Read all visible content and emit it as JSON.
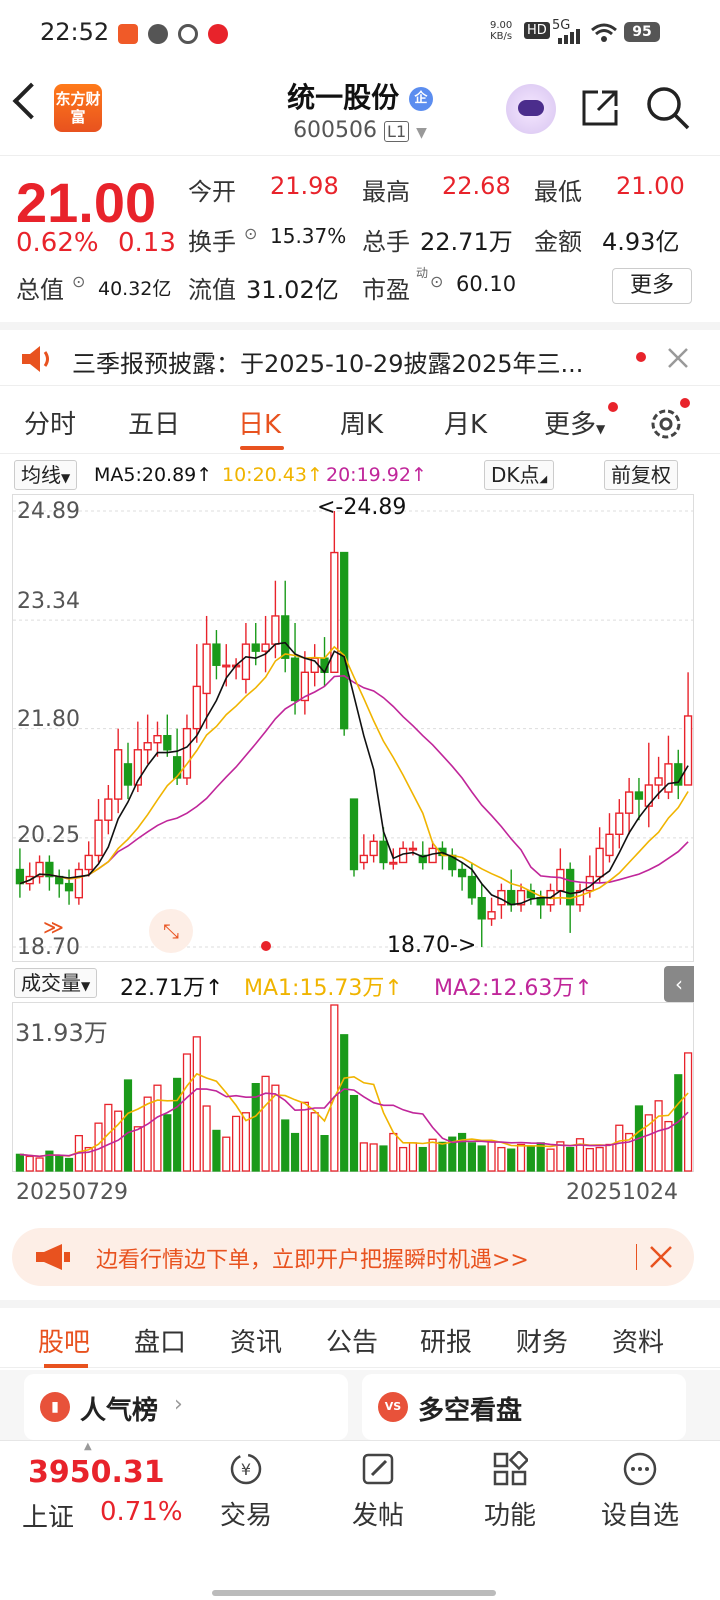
{
  "status_bar": {
    "time": "22:52",
    "net_speed": "9.00\nKB/s",
    "net_speed_top": "9.00",
    "net_speed_bottom": "KB/s",
    "hd": "HD",
    "signal": "5G",
    "battery": "95"
  },
  "header": {
    "logo_text": "东方财富",
    "stock_name": "统一股份",
    "stock_badge": "企",
    "stock_code": "600506",
    "level": "L1"
  },
  "quote": {
    "price": "21.00",
    "change_pct": "0.62%",
    "change_amt": "0.13",
    "open_label": "今开",
    "open_value": "21.98",
    "high_label": "最高",
    "high_value": "22.68",
    "low_label": "最低",
    "low_value": "21.00",
    "turnover_label": "换手",
    "turnover_value": "15.37%",
    "volume_label": "总手",
    "volume_value": "22.71万",
    "amount_label": "金额",
    "amount_value": "4.93亿",
    "mktcap_label": "总值",
    "mktcap_value": "40.32亿",
    "float_label": "流值",
    "float_value": "31.02亿",
    "pe_label": "市盈",
    "pe_sup": "动",
    "pe_value": "60.10",
    "more_label": "更多"
  },
  "notice": {
    "text": "三季报预披露：于2025-10-29披露2025年三..."
  },
  "period_tabs": [
    "分时",
    "五日",
    "日K",
    "周K",
    "月K",
    "更多"
  ],
  "active_period": "日K",
  "chart_toolbar": {
    "ma_select": "均线",
    "ma5": "MA5:20.89↑",
    "ma10": "10:20.43↑",
    "ma20": "20:19.92↑",
    "dk_label": "DK点",
    "adjust_label": "前复权"
  },
  "colors": {
    "up": "#e8232b",
    "down": "#1a9a1a",
    "accent": "#e8521f",
    "ma5": "#111111",
    "ma10": "#f0b400",
    "ma20": "#c0269a"
  },
  "chart_data": {
    "type": "candlestick",
    "y_ticks": [
      "24.89",
      "23.34",
      "21.80",
      "20.25",
      "18.70"
    ],
    "ylim": [
      18.7,
      24.89
    ],
    "max_annotation": "<-24.89",
    "min_annotation": "18.70->",
    "x_start": "20250729",
    "x_end": "20251024",
    "candles": [
      [
        19.8,
        19.6,
        20.1,
        19.4
      ],
      [
        19.6,
        19.7,
        19.9,
        19.5
      ],
      [
        19.7,
        19.9,
        20.0,
        19.6
      ],
      [
        19.9,
        19.7,
        20.0,
        19.5
      ],
      [
        19.7,
        19.6,
        19.8,
        19.4
      ],
      [
        19.6,
        19.5,
        19.8,
        19.3
      ],
      [
        19.4,
        19.8,
        19.9,
        19.3
      ],
      [
        19.8,
        20.0,
        20.2,
        19.7
      ],
      [
        20.0,
        20.5,
        20.8,
        19.9
      ],
      [
        20.5,
        20.8,
        21.0,
        20.3
      ],
      [
        20.8,
        21.5,
        21.8,
        20.6
      ],
      [
        21.3,
        21.0,
        21.6,
        20.8
      ],
      [
        21.0,
        21.5,
        21.9,
        20.9
      ],
      [
        21.5,
        21.6,
        22.0,
        21.3
      ],
      [
        21.6,
        21.7,
        21.9,
        21.4
      ],
      [
        21.7,
        21.5,
        22.0,
        21.4
      ],
      [
        21.4,
        21.1,
        21.8,
        21.0
      ],
      [
        21.1,
        21.8,
        22.0,
        21.0
      ],
      [
        21.8,
        22.4,
        23.0,
        21.6
      ],
      [
        22.3,
        23.0,
        23.4,
        21.8
      ],
      [
        23.0,
        22.7,
        23.2,
        22.5
      ],
      [
        22.7,
        22.7,
        23.0,
        22.4
      ],
      [
        22.7,
        22.7,
        22.8,
        22.5
      ],
      [
        22.5,
        23.0,
        23.3,
        22.3
      ],
      [
        23.0,
        22.9,
        23.3,
        22.7
      ],
      [
        22.9,
        23.0,
        23.4,
        22.6
      ],
      [
        23.0,
        23.4,
        23.9,
        22.8
      ],
      [
        23.4,
        22.8,
        23.9,
        22.6
      ],
      [
        22.8,
        22.2,
        23.3,
        22.0
      ],
      [
        22.2,
        22.6,
        22.9,
        22.0
      ],
      [
        22.6,
        22.8,
        23.0,
        22.4
      ],
      [
        22.8,
        22.6,
        23.1,
        22.4
      ],
      [
        22.6,
        24.3,
        24.89,
        22.6
      ],
      [
        24.3,
        21.8,
        24.3,
        21.7
      ],
      [
        20.8,
        19.8,
        20.8,
        19.7
      ],
      [
        19.9,
        20.0,
        20.3,
        19.8
      ],
      [
        20.0,
        20.2,
        20.3,
        19.9
      ],
      [
        20.2,
        19.9,
        20.4,
        19.8
      ],
      [
        19.9,
        19.9,
        20.1,
        19.8
      ],
      [
        19.9,
        20.1,
        20.2,
        19.9
      ],
      [
        20.1,
        20.1,
        20.2,
        20.0
      ],
      [
        20.0,
        19.9,
        20.2,
        19.8
      ],
      [
        19.9,
        20.1,
        20.2,
        19.9
      ],
      [
        20.1,
        20.0,
        20.2,
        19.8
      ],
      [
        20.0,
        19.8,
        20.1,
        19.7
      ],
      [
        19.8,
        19.7,
        19.9,
        19.5
      ],
      [
        19.7,
        19.4,
        19.9,
        19.3
      ],
      [
        19.4,
        19.1,
        19.6,
        18.7
      ],
      [
        19.1,
        19.2,
        19.4,
        19.0
      ],
      [
        19.3,
        19.5,
        19.6,
        19.1
      ],
      [
        19.5,
        19.3,
        19.8,
        19.2
      ],
      [
        19.3,
        19.5,
        19.6,
        19.2
      ],
      [
        19.5,
        19.4,
        19.6,
        19.3
      ],
      [
        19.4,
        19.3,
        19.5,
        19.1
      ],
      [
        19.3,
        19.5,
        19.6,
        19.2
      ],
      [
        19.5,
        19.8,
        20.1,
        19.3
      ],
      [
        19.8,
        19.3,
        19.9,
        18.9
      ],
      [
        19.3,
        19.5,
        19.6,
        19.2
      ],
      [
        19.5,
        19.7,
        20.0,
        19.4
      ],
      [
        19.7,
        20.1,
        20.4,
        19.6
      ],
      [
        20.0,
        20.3,
        20.6,
        19.9
      ],
      [
        20.3,
        20.6,
        20.8,
        20.1
      ],
      [
        20.6,
        20.9,
        21.1,
        20.3
      ],
      [
        20.9,
        20.8,
        21.1,
        20.5
      ],
      [
        20.7,
        21.0,
        21.6,
        20.4
      ],
      [
        21.0,
        21.1,
        21.4,
        20.8
      ],
      [
        20.9,
        21.3,
        21.7,
        20.8
      ],
      [
        21.3,
        21.0,
        21.5,
        20.8
      ],
      [
        21.0,
        21.98,
        22.6,
        21.0
      ]
    ]
  },
  "volume_toolbar": {
    "label": "成交量",
    "value": "22.71万↑",
    "ma1": "MA1:15.73万↑",
    "ma2": "MA2:12.63万↑",
    "max_label": "31.93万"
  },
  "volume_data": [
    3.2,
    2.8,
    2.5,
    3.8,
    2.9,
    2.4,
    6.8,
    4.5,
    9.2,
    12.8,
    11.5,
    17.5,
    8.5,
    14.2,
    16.5,
    10.8,
    17.8,
    22.5,
    25.8,
    12.5,
    7.8,
    6.5,
    10.5,
    11.2,
    16.8,
    18.2,
    16.5,
    9.8,
    7.2,
    13.2,
    11.2,
    6.8,
    31.93,
    26.2,
    14.5,
    5.4,
    5.2,
    4.8,
    7.2,
    4.5,
    5.4,
    4.5,
    6.1,
    5.5,
    6.5,
    7.2,
    5.4,
    4.8,
    5.6,
    4.5,
    4.2,
    5.1,
    4.8,
    5.4,
    4.2,
    5.6,
    4.5,
    6.2,
    4.3,
    4.5,
    5.1,
    8.8,
    7.2,
    12.5,
    10.8,
    13.5,
    9.5,
    18.5,
    22.71
  ],
  "x_axis": {
    "start": "20250729",
    "end": "20251024"
  },
  "promo": {
    "text": "边看行情边下单，立即开户把握瞬时机遇>>"
  },
  "section_tabs": [
    "股吧",
    "盘口",
    "资讯",
    "公告",
    "研报",
    "财务",
    "资料"
  ],
  "active_section": "股吧",
  "cards": {
    "popularity": "人气榜",
    "duokong": "多空看盘"
  },
  "bottom_nav": {
    "index_value": "3950.31",
    "index_name": "上证",
    "index_change": "0.71%",
    "items": [
      "交易",
      "发帖",
      "功能",
      "设自选"
    ]
  }
}
